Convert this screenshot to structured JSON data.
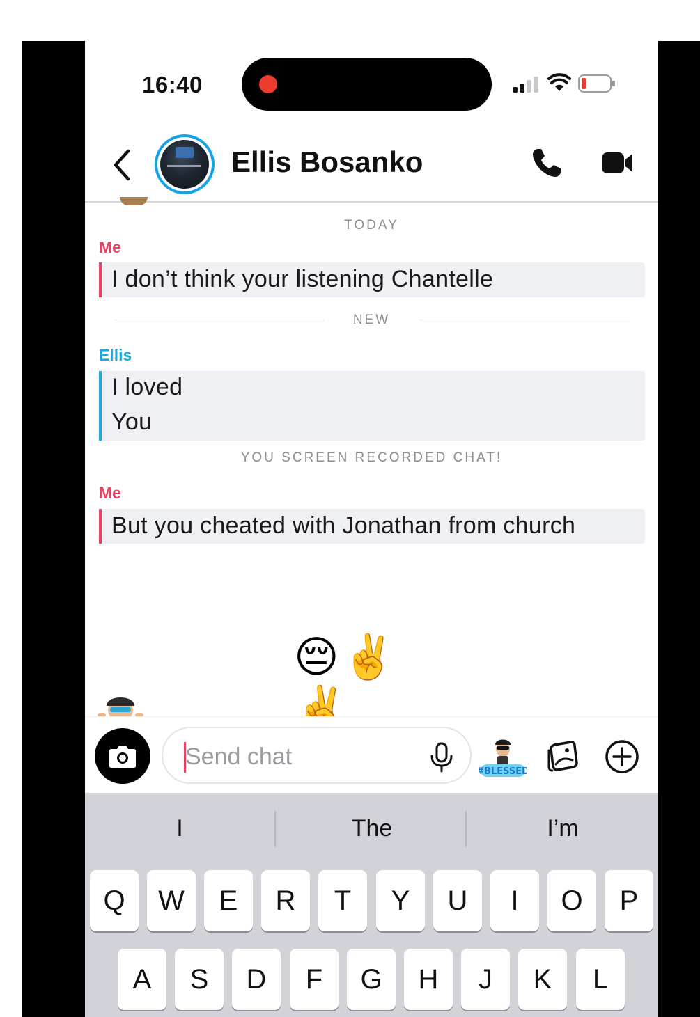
{
  "status_bar": {
    "time": "16:40"
  },
  "header": {
    "contact_name": "Ellis Bosanko"
  },
  "chat": {
    "day_divider": "TODAY",
    "new_divider": "NEW",
    "screen_record_notice": "YOU SCREEN RECORDED CHAT!",
    "messages": [
      {
        "sender": "Me",
        "lines": [
          "I don’t think your listening Chantelle"
        ]
      },
      {
        "sender": "Ellis",
        "lines": [
          "I loved",
          "You"
        ]
      },
      {
        "sender": "Me",
        "lines": [
          "But you cheated with Jonathan from church"
        ]
      }
    ],
    "emoji_message": "😔✌️✌️"
  },
  "input": {
    "placeholder": "Send chat",
    "bitmoji_sticker_text": "#BLESSED"
  },
  "keyboard": {
    "suggestions": [
      "I",
      "The",
      "I’m"
    ],
    "row1": [
      "Q",
      "W",
      "E",
      "R",
      "T",
      "Y",
      "U",
      "I",
      "O",
      "P"
    ],
    "row2": [
      "A",
      "S",
      "D",
      "F",
      "G",
      "H",
      "J",
      "K",
      "L"
    ]
  },
  "colors": {
    "me_accent": "#e84162",
    "ellis_accent": "#1ea7e3",
    "recording_dot": "#ee3b30"
  }
}
